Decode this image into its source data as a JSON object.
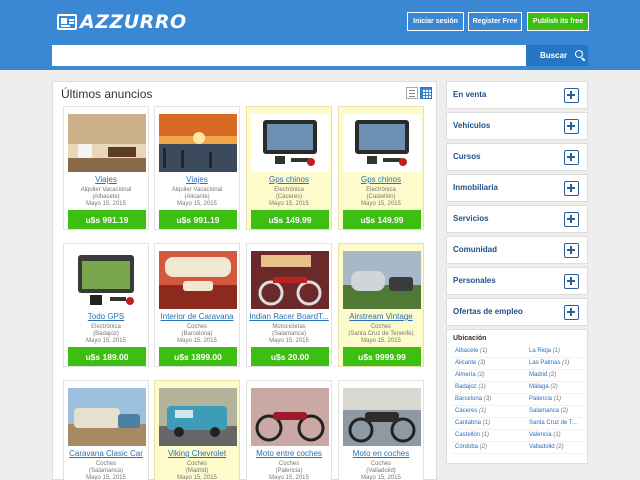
{
  "header": {
    "logo_text": "AZZURRO",
    "login_label": "Iniciar sesión",
    "register_label": "Register Free",
    "publish_label": "Publish its free",
    "search_placeholder": "",
    "search_label": "Buscar"
  },
  "listings": {
    "title": "Últimos anuncios",
    "items": [
      {
        "title": "Viajes",
        "category": "Alquiler Vacacional",
        "location": "(Albacete)",
        "date": "Mayo 15, 2015",
        "price": "u$s 991.19",
        "featured": false
      },
      {
        "title": "Viajes",
        "category": "Alquiler Vacacional",
        "location": "(Alicante)",
        "date": "Mayo 15, 2015",
        "price": "u$s 991.19",
        "featured": false
      },
      {
        "title": "Gps chinos",
        "category": "Electrónica",
        "location": "(Cáceres)",
        "date": "Mayo 15, 2015",
        "price": "u$s 149.99",
        "featured": true
      },
      {
        "title": "Gps chinos",
        "category": "Electrónica",
        "location": "(Castellón)",
        "date": "Mayo 15, 2015",
        "price": "u$s 149.99",
        "featured": true
      },
      {
        "title": "Todo GPS",
        "category": "Electrónica",
        "location": "(Badajoz)",
        "date": "Mayo 15, 2015",
        "price": "u$s 189.00",
        "featured": false
      },
      {
        "title": "Interior de Caravana",
        "category": "Coches",
        "location": "(Barcelona)",
        "date": "Mayo 15, 2015",
        "price": "u$s 1899.00",
        "featured": false
      },
      {
        "title": "Indian Racer BoardT...",
        "category": "Motocicletas",
        "location": "(Salamanca)",
        "date": "Mayo 15, 2015",
        "price": "u$s 20.00",
        "featured": false
      },
      {
        "title": "Airstream Vintage",
        "category": "Coches",
        "location": "(Santa Cruz de Tenerife)",
        "date": "Mayo 15, 2015",
        "price": "u$s 9999.99",
        "featured": true
      },
      {
        "title": "Caravana Clasic Car",
        "category": "Coches",
        "location": "(Salamanca)",
        "date": "Mayo 15, 2015",
        "price": "",
        "featured": false
      },
      {
        "title": "Viking Chevrolet",
        "category": "Coches",
        "location": "(Madrid)",
        "date": "Mayo 15, 2015",
        "price": "",
        "featured": true
      },
      {
        "title": "Moto entre coches",
        "category": "Coches",
        "location": "(Palencia)",
        "date": "Mayo 15, 2015",
        "price": "",
        "featured": false
      },
      {
        "title": "Moto en coches",
        "category": "Coches",
        "location": "(Valladolid)",
        "date": "Mayo 15, 2015",
        "price": "",
        "featured": false
      }
    ]
  },
  "sidebar": {
    "categories": [
      "En venta",
      "Vehículos",
      "Cursos",
      "Inmobiliaria",
      "Servicios",
      "Comunidad",
      "Personales",
      "Ofertas de empleo"
    ],
    "location_title": "Ubicación",
    "locations_left": [
      {
        "name": "Albacete",
        "count": "(1)"
      },
      {
        "name": "Alicante",
        "count": "(3)"
      },
      {
        "name": "Almería",
        "count": "(2)"
      },
      {
        "name": "Badajoz",
        "count": "(1)"
      },
      {
        "name": "Barcelona",
        "count": "(3)"
      },
      {
        "name": "Cáceres",
        "count": "(1)"
      },
      {
        "name": "Cantabria",
        "count": "(1)"
      },
      {
        "name": "Castellón",
        "count": "(1)"
      },
      {
        "name": "Córdoba",
        "count": "(2)"
      }
    ],
    "locations_right": [
      {
        "name": "La Rioja",
        "count": "(1)"
      },
      {
        "name": "Las Palmas",
        "count": "(1)"
      },
      {
        "name": "Madrid",
        "count": "(2)"
      },
      {
        "name": "Málaga",
        "count": "(2)"
      },
      {
        "name": "Palencia",
        "count": "(1)"
      },
      {
        "name": "Salamanca",
        "count": "(2)"
      },
      {
        "name": "Santa Cruz de T...",
        "count": ""
      },
      {
        "name": "Valencia",
        "count": "(1)"
      },
      {
        "name": "Valladolid",
        "count": "(2)"
      }
    ]
  }
}
